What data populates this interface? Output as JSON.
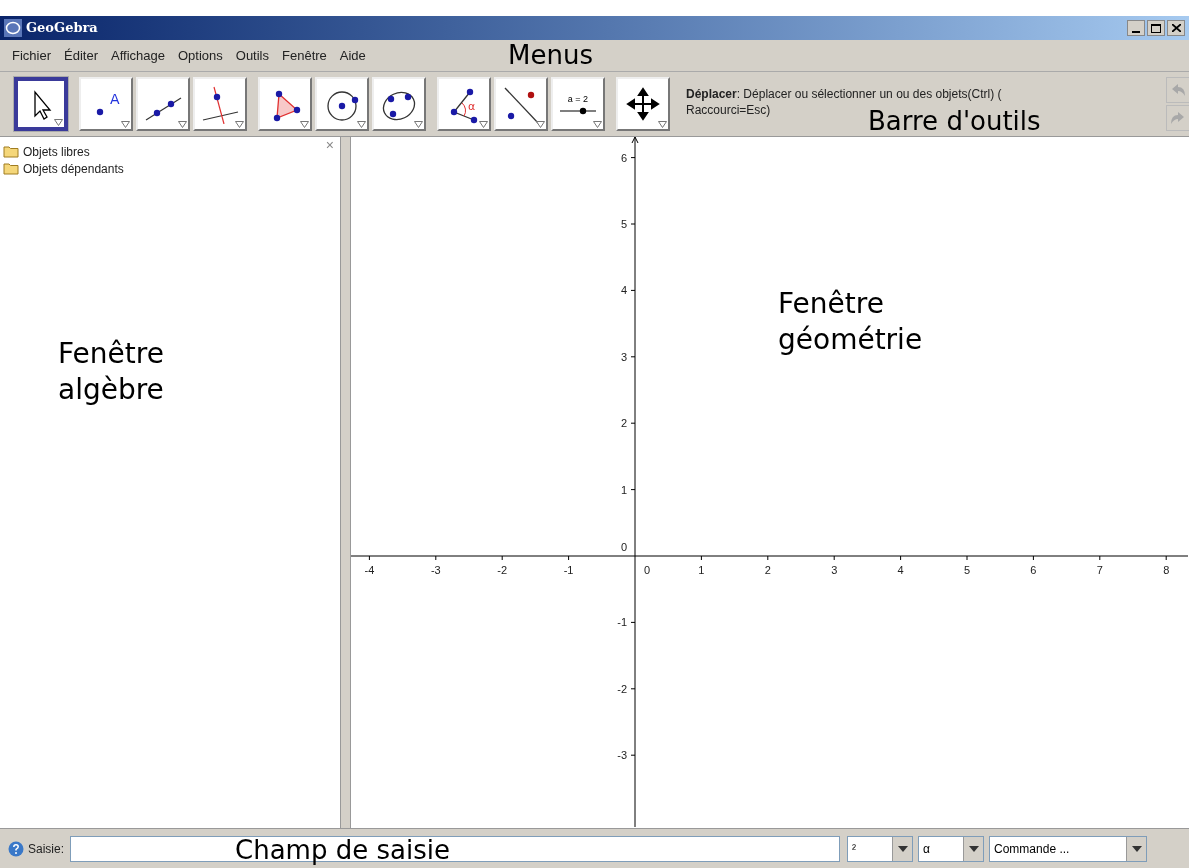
{
  "window": {
    "title": "GeoGebra"
  },
  "menus": [
    "Fichier",
    "Éditer",
    "Affichage",
    "Options",
    "Outils",
    "Fenêtre",
    "Aide"
  ],
  "toolbar": {
    "groups": [
      [
        {
          "kind": "move",
          "selected": true
        }
      ],
      [
        {
          "kind": "point",
          "selected": false,
          "label": "A"
        },
        {
          "kind": "line",
          "selected": false
        },
        {
          "kind": "perpendicular",
          "selected": false
        }
      ],
      [
        {
          "kind": "polygon",
          "selected": false
        },
        {
          "kind": "circle",
          "selected": false
        },
        {
          "kind": "conic",
          "selected": false
        }
      ],
      [
        {
          "kind": "angle",
          "selected": false,
          "label": "α"
        },
        {
          "kind": "reflect",
          "selected": false
        },
        {
          "kind": "slider",
          "selected": false,
          "label": "a = 2"
        }
      ],
      [
        {
          "kind": "translate",
          "selected": false
        }
      ]
    ],
    "help_lines": [
      "**Déplacer**: Déplacer ou sélectionner un ou des objets(Ctrl) (",
      "Raccourci=Esc)"
    ],
    "undo_disabled": true,
    "redo_disabled": true
  },
  "algebra": {
    "close": "×",
    "items": [
      {
        "label": "Objets libres"
      },
      {
        "label": "Objets dépendants"
      }
    ]
  },
  "graphics": {
    "x_ticks": [
      "-4",
      "-3",
      "-2",
      "-1",
      "0",
      "1",
      "2",
      "3",
      "4",
      "5",
      "6",
      "7",
      "8"
    ],
    "y_ticks": [
      "6",
      "5",
      "4",
      "3",
      "2",
      "1",
      "0",
      "-1",
      "-2",
      "-3"
    ]
  },
  "input_bar": {
    "label": "Saisie:",
    "dropdowns": [
      "²",
      "α",
      "Commande ..."
    ]
  },
  "annotations": {
    "menus": "Menus",
    "toolbar": "Barre d'outils",
    "algebra": [
      "Fenêtre",
      "algèbre"
    ],
    "graphics": [
      "Fenêtre",
      "géométrie"
    ],
    "input": "Champ de saisie"
  }
}
